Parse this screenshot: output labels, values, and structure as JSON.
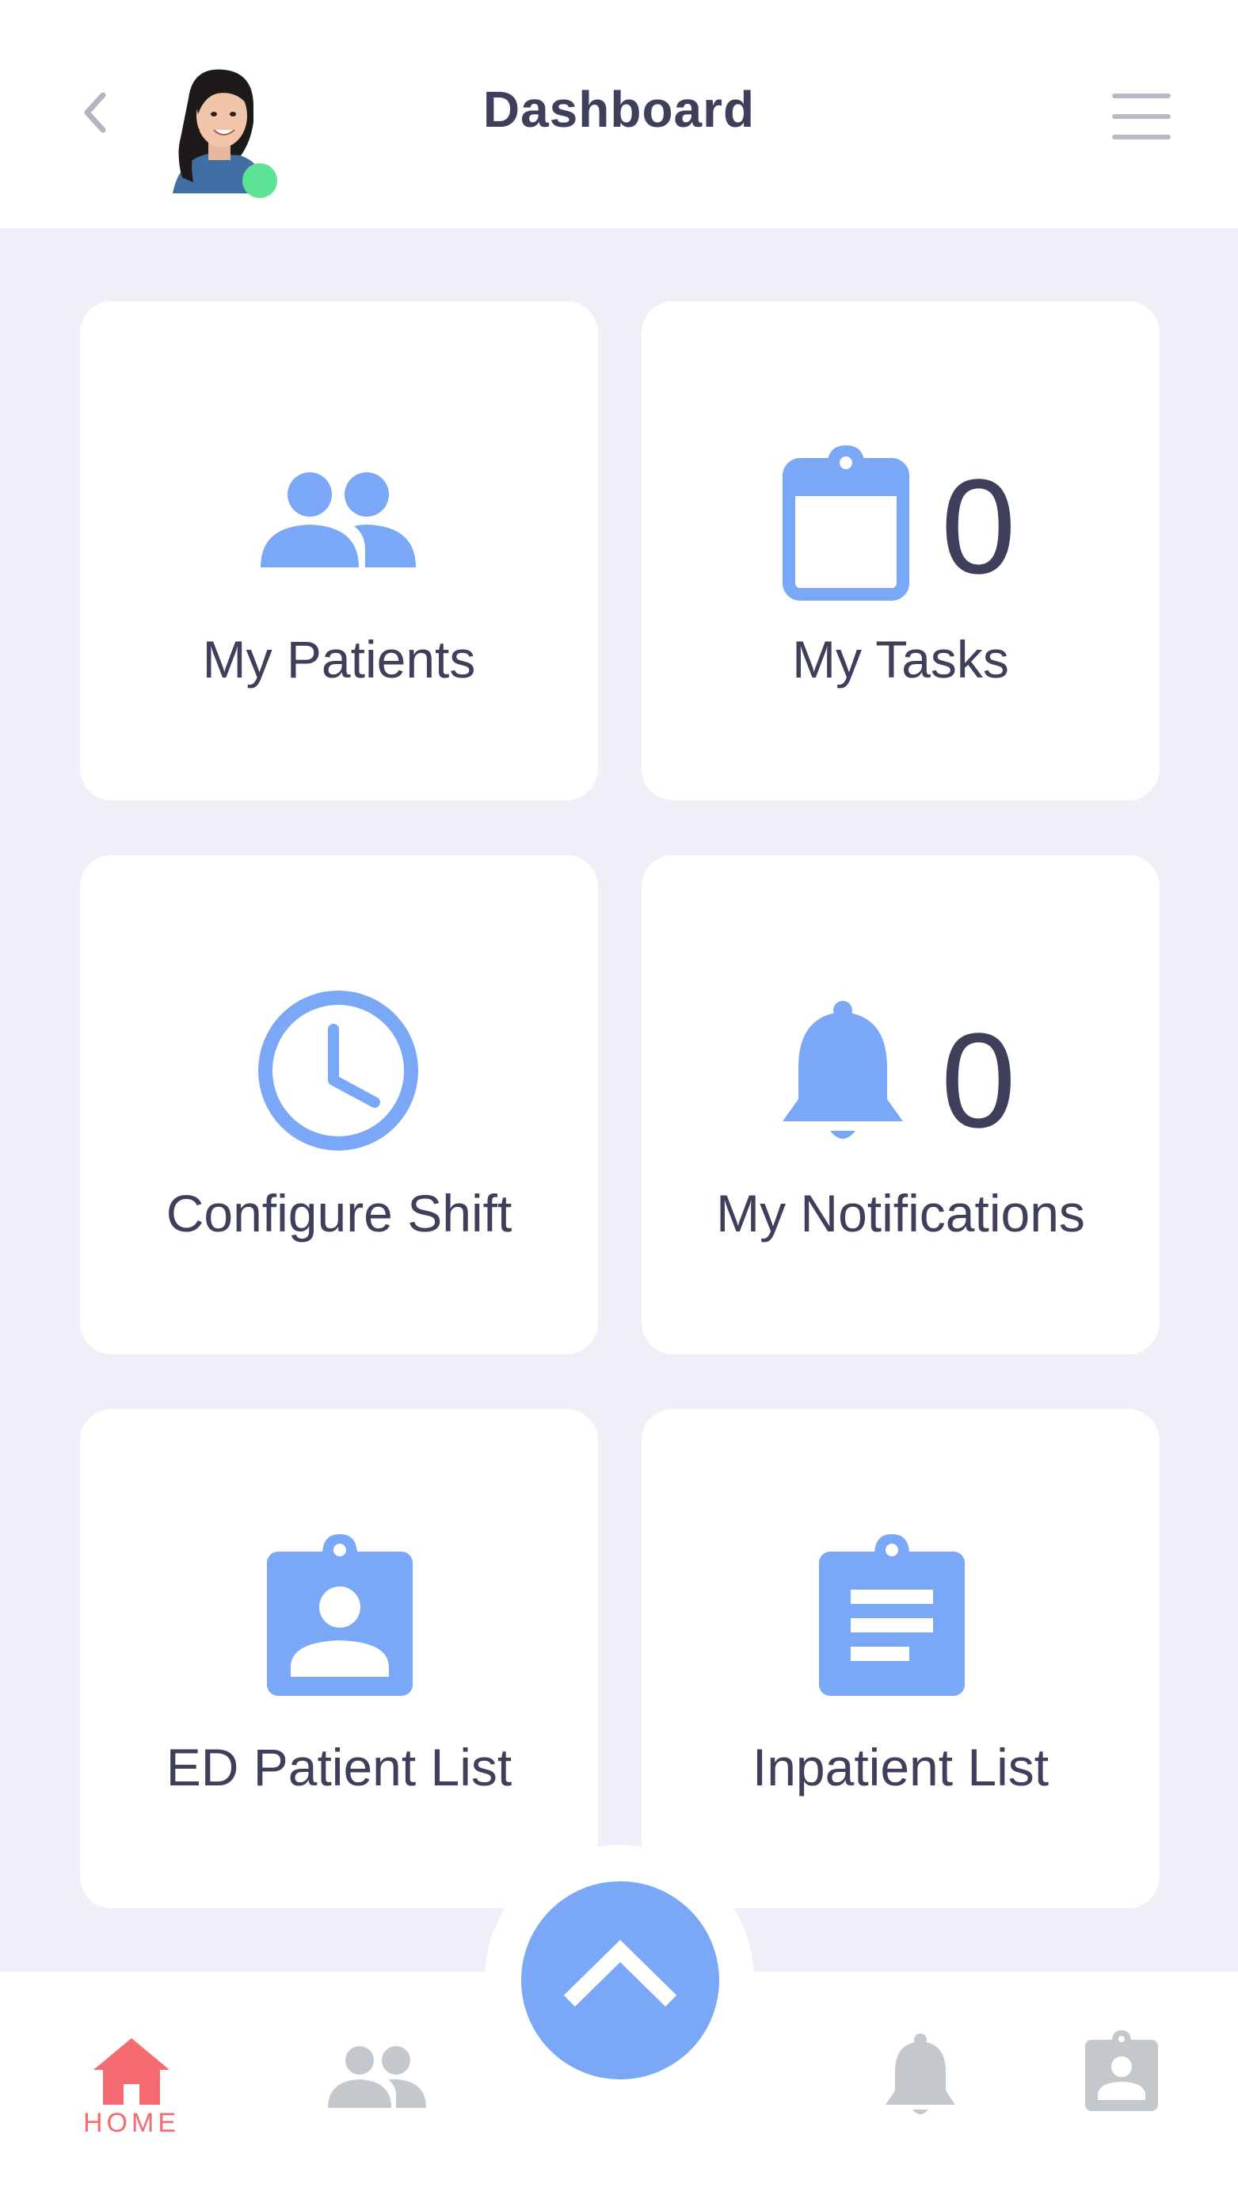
{
  "header": {
    "title": "Dashboard",
    "status": "online"
  },
  "cards": {
    "my_patients": {
      "label": "My Patients",
      "icon": "people-icon"
    },
    "my_tasks": {
      "label": "My Tasks",
      "count": "0",
      "icon": "clipboard-icon"
    },
    "configure_shift": {
      "label": "Configure Shift",
      "icon": "clock-icon"
    },
    "my_notifications": {
      "label": "My Notifications",
      "count": "0",
      "icon": "bell-icon"
    },
    "ed_patient_list": {
      "label": "ED Patient List",
      "icon": "patient-badge-icon"
    },
    "inpatient_list": {
      "label": "Inpatient List",
      "icon": "document-clipboard-icon"
    }
  },
  "bottom_nav": {
    "home_label": "HOME",
    "items": [
      "home-icon",
      "people-icon",
      "expand-up-icon",
      "bell-icon",
      "patient-badge-icon"
    ]
  },
  "colors": {
    "accent": "#7aa8f7",
    "active": "#f56b71",
    "inactive": "#c3c8cc",
    "text": "#3e3f5b",
    "background": "#eff0f7",
    "online": "#5ce396"
  }
}
